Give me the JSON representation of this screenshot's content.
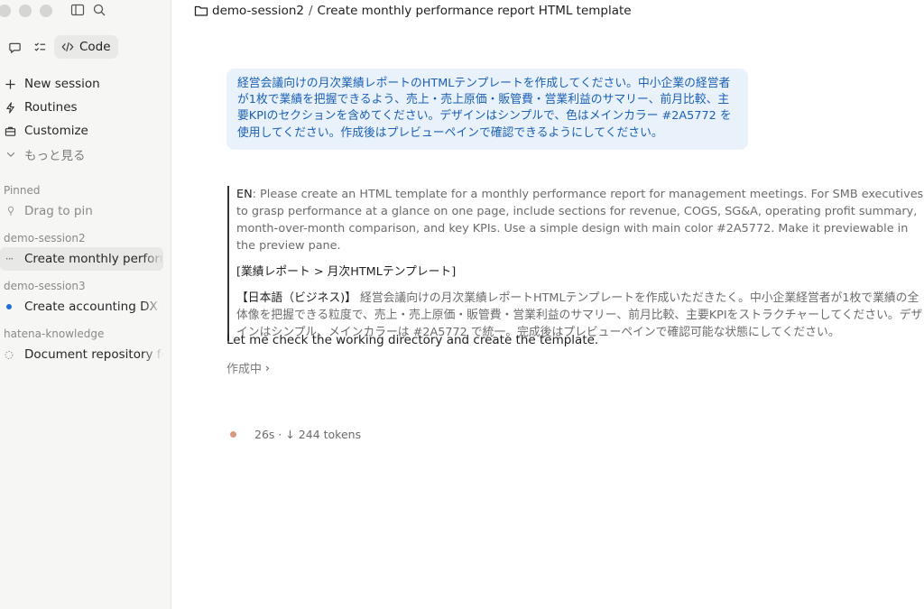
{
  "sidebar": {
    "code_tab": "Code",
    "nav": [
      {
        "icon": "plus-icon",
        "label": "New session"
      },
      {
        "icon": "lightning-icon",
        "label": "Routines"
      },
      {
        "icon": "briefcase-icon",
        "label": "Customize"
      },
      {
        "icon": "chevron-down-icon",
        "label": "もっと見る"
      }
    ],
    "pinned_label": "Pinned",
    "pin_placeholder": "Drag to pin",
    "groups": [
      {
        "name": "demo-session2",
        "item": "Create monthly performance report HTML template",
        "status": "running"
      },
      {
        "name": "demo-session3",
        "item": "Create accounting DX presentation",
        "status": "active"
      },
      {
        "name": "hatena-knowledge",
        "item": "Document repository folder structure",
        "status": "pending"
      }
    ]
  },
  "breadcrumb": {
    "folder": "demo-session2",
    "separator": "/",
    "title": "Create monthly performance report HTML template"
  },
  "chat": {
    "user_message": "経営会議向けの月次業績レポートのHTMLテンプレートを作成してください。中小企業の経営者が1枚で業績を把握できるよう、売上・売上原価・販管費・営業利益のサマリー、前月比較、主要KPIのセクションを含めてください。デザインはシンプルで、色はメインカラー #2A5772 を使用してください。作成後はプレビューペインで確認できるようにしてください。",
    "quote": {
      "en_prefix": "EN",
      "en_text": ": Please create an HTML template for a monthly performance report for management meetings. For SMB executives to grasp performance at a glance on one page, include sections for revenue, COGS, SG&A, operating profit summary, month-over-month comparison, and key KPIs. Use a simple design with main color #2A5772. Make it previewable in the preview pane.",
      "heading": "[業績レポート > 月次HTMLテンプレート]",
      "jp_prefix": "【日本語（ビジネス)】",
      "jp_text": " 経営会議向けの月次業績レポートHTMLテンプレートを作成いただきたく。中小企業経営者が1枚で業績の全体像を把握できる粒度で、売上・売上原価・販管費・営業利益のサマリー、前月比較、主要KPIをストラクチャーしてください。デザインはシンプル、メインカラーは #2A5772 で統一。完成後はプレビューペインで確認可能な状態にしてください。"
    },
    "assistant_message": "Let me check the working directory and create the template.",
    "status": "作成中",
    "stats": "26s · ↓ 244 tokens"
  },
  "colors": {
    "accent": "#1a5fb4",
    "bubble": "#e9f2fb",
    "active_dot": "#1e6fd9",
    "stats_dot": "#d99a83"
  }
}
